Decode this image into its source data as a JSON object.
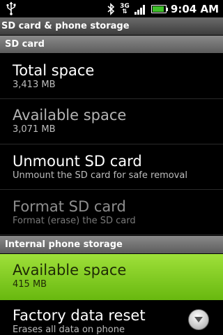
{
  "status_bar": {
    "time": "9:04 AM",
    "network": "3G",
    "battery_level": 0.9,
    "icons": [
      "usb-icon",
      "bluetooth-icon",
      "3g-data-icon",
      "signal-icon",
      "battery-icon"
    ]
  },
  "title": "SD card & phone storage",
  "sections": {
    "sd_card": {
      "header": "SD card",
      "items": [
        {
          "title": "Total space",
          "summary": "3,413 MB"
        },
        {
          "title": "Available space",
          "summary": "3,071 MB"
        },
        {
          "title": "Unmount SD card",
          "summary": "Unmount the SD card for safe removal"
        },
        {
          "title": "Format SD card",
          "summary": "Format (erase) the SD card"
        }
      ]
    },
    "internal": {
      "header": "Internal phone storage",
      "items": [
        {
          "title": "Available space",
          "summary": "415 MB"
        },
        {
          "title": "Factory data reset",
          "summary": "Erases all data on phone"
        }
      ]
    }
  },
  "colors": {
    "highlight_top": "#9fe03a",
    "highlight_bottom": "#68b80f",
    "header_bg": "#6b6b6b"
  }
}
